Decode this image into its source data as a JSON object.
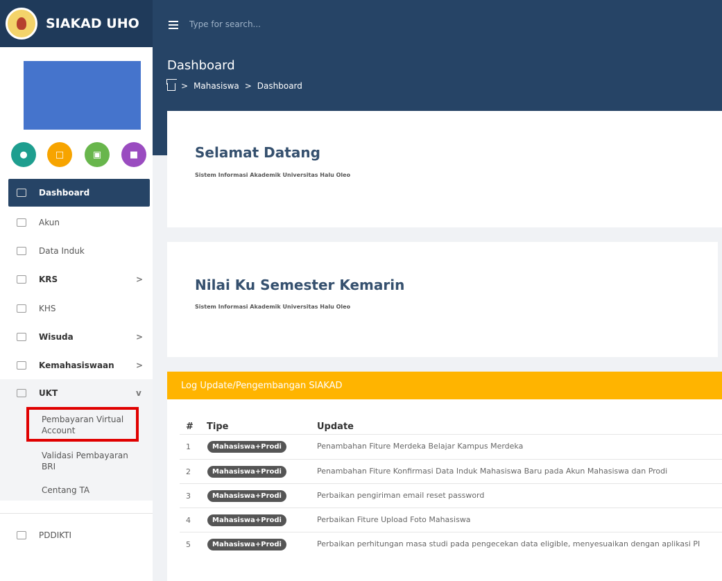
{
  "app": {
    "brand": "SIAKAD UHO",
    "search_placeholder": "Type for search..."
  },
  "header": {
    "title": "Dashboard",
    "breadcrumb": [
      "Mahasiswa",
      "Dashboard"
    ]
  },
  "sidebar": {
    "quick_actions": [
      {
        "icon": "user-icon",
        "color": "#1e9e8f"
      },
      {
        "icon": "chat-icon",
        "color": "#f7a400"
      },
      {
        "icon": "monitor-icon",
        "color": "#68b64c"
      },
      {
        "icon": "lock-icon",
        "color": "#9a4cc0"
      }
    ],
    "items": [
      {
        "label": "Dashboard",
        "icon": "dashboard-icon"
      },
      {
        "label": "Akun",
        "icon": "account-icon"
      },
      {
        "label": "Data Induk",
        "icon": "folder-icon"
      },
      {
        "label": "KRS",
        "icon": "graduation-icon",
        "chevron": ">"
      },
      {
        "label": "KHS",
        "icon": "card-icon"
      },
      {
        "label": "Wisuda",
        "icon": "gear-icon",
        "chevron": ">"
      },
      {
        "label": "Kemahasiswaan",
        "icon": "institution-icon",
        "chevron": ">"
      },
      {
        "label": "UKT",
        "icon": "receipt-icon",
        "chevron": "v"
      }
    ],
    "sub_items": [
      "Pembayaran Virtual Account",
      "Validasi Pembayaran BRI",
      "Centang TA"
    ],
    "extra": {
      "label": "PDDIKTI",
      "icon": "people-icon"
    }
  },
  "cards": [
    {
      "title": "Selamat Datang",
      "subtitle": "Sistem Informasi Akademik Universitas Halu Oleo"
    },
    {
      "title": "Nilai Ku Semester Kemarin",
      "subtitle": "Sistem Informasi Akademik Universitas Halu Oleo"
    }
  ],
  "log": {
    "title": "Log Update/Pengembangan SIAKAD",
    "columns": [
      "#",
      "Tipe",
      "Update"
    ],
    "rows": [
      {
        "num": "1",
        "type": "Mahasiswa+Prodi",
        "update": "Penambahan Fiture Merdeka Belajar Kampus Merdeka"
      },
      {
        "num": "2",
        "type": "Mahasiswa+Prodi",
        "update": "Penambahan Fiture Konfirmasi Data Induk Mahasiswa Baru pada Akun Mahasiswa dan Prodi"
      },
      {
        "num": "3",
        "type": "Mahasiswa+Prodi",
        "update": "Perbaikan pengiriman email reset password"
      },
      {
        "num": "4",
        "type": "Mahasiswa+Prodi",
        "update": "Perbaikan Fiture Upload Foto Mahasiswa"
      },
      {
        "num": "5",
        "type": "Mahasiswa+Prodi",
        "update": "Perbaikan perhitungan masa studi pada pengecekan data eligible, menyesuaikan dengan aplikasi PI"
      }
    ]
  }
}
